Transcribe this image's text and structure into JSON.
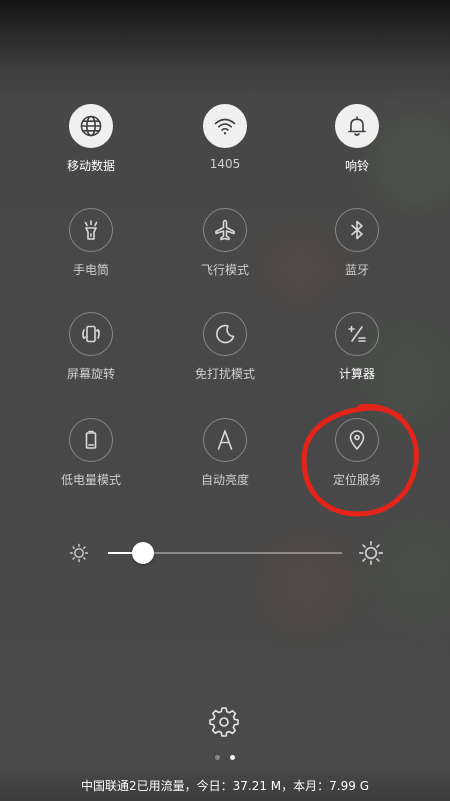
{
  "colors": {
    "background": "#474747",
    "accent_annotation": "#e42419",
    "active_toggle": "#f0f0f0"
  },
  "toggles": [
    {
      "label": "移动数据",
      "icon": "globe-icon",
      "active": true
    },
    {
      "label": "1405",
      "icon": "wifi-icon",
      "active": true
    },
    {
      "label": "响铃",
      "icon": "bell-icon",
      "active": true
    },
    {
      "label": "手电筒",
      "icon": "flashlight-icon",
      "active": false
    },
    {
      "label": "飞行模式",
      "icon": "airplane-icon",
      "active": false
    },
    {
      "label": "蓝牙",
      "icon": "bluetooth-icon",
      "active": false
    },
    {
      "label": "屏幕旋转",
      "icon": "screen-rotation-icon",
      "active": false
    },
    {
      "label": "免打扰模式",
      "icon": "moon-icon",
      "active": false
    },
    {
      "label": "计算器",
      "icon": "calculator-icon",
      "active": false
    },
    {
      "label": "低电量模式",
      "icon": "battery-low-icon",
      "active": false
    },
    {
      "label": "自动亮度",
      "icon": "auto-brightness-icon",
      "active": false
    },
    {
      "label": "定位服务",
      "icon": "location-pin-icon",
      "active": false
    }
  ],
  "brightness": {
    "level": 0.15,
    "min_icon": "sun-small-icon",
    "max_icon": "sun-large-icon"
  },
  "settings_icon": "gear-icon",
  "pager": {
    "count": 2,
    "current": 2
  },
  "footer": {
    "text": "中国联通2已用流量，今日：37.21 M，本月：7.99 G"
  }
}
